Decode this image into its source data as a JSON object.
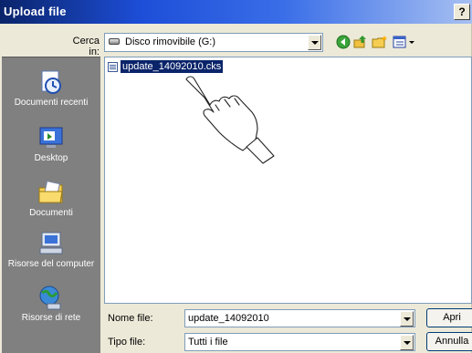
{
  "window": {
    "title": "Upload file",
    "help_label": "?"
  },
  "lookin": {
    "label": "Cerca in:",
    "value": "Disco rimovibile (G:)"
  },
  "toolbar": {
    "back_icon": "back-arrow-icon",
    "up_icon": "up-folder-icon",
    "newfolder_icon": "new-folder-icon",
    "views_icon": "views-menu-icon"
  },
  "places": [
    {
      "label": "Documenti recenti",
      "icon": "recent-documents-icon"
    },
    {
      "label": "Desktop",
      "icon": "desktop-icon"
    },
    {
      "label": "Documenti",
      "icon": "documents-folder-icon"
    },
    {
      "label": "Risorse del computer",
      "icon": "my-computer-icon"
    },
    {
      "label": "Risorse di rete",
      "icon": "network-icon"
    }
  ],
  "files": [
    {
      "name": "update_14092010.cks",
      "selected": true
    }
  ],
  "filename": {
    "label": "Nome file:",
    "value": "update_14092010"
  },
  "filetype": {
    "label": "Tipo file:",
    "value": "Tutti i file"
  },
  "buttons": {
    "open": "Apri",
    "cancel": "Annulla"
  },
  "colors": {
    "titlebar": "#0a246a",
    "selection": "#0a246a",
    "places_bg": "#808080",
    "dialog_bg": "#ece9d8"
  }
}
